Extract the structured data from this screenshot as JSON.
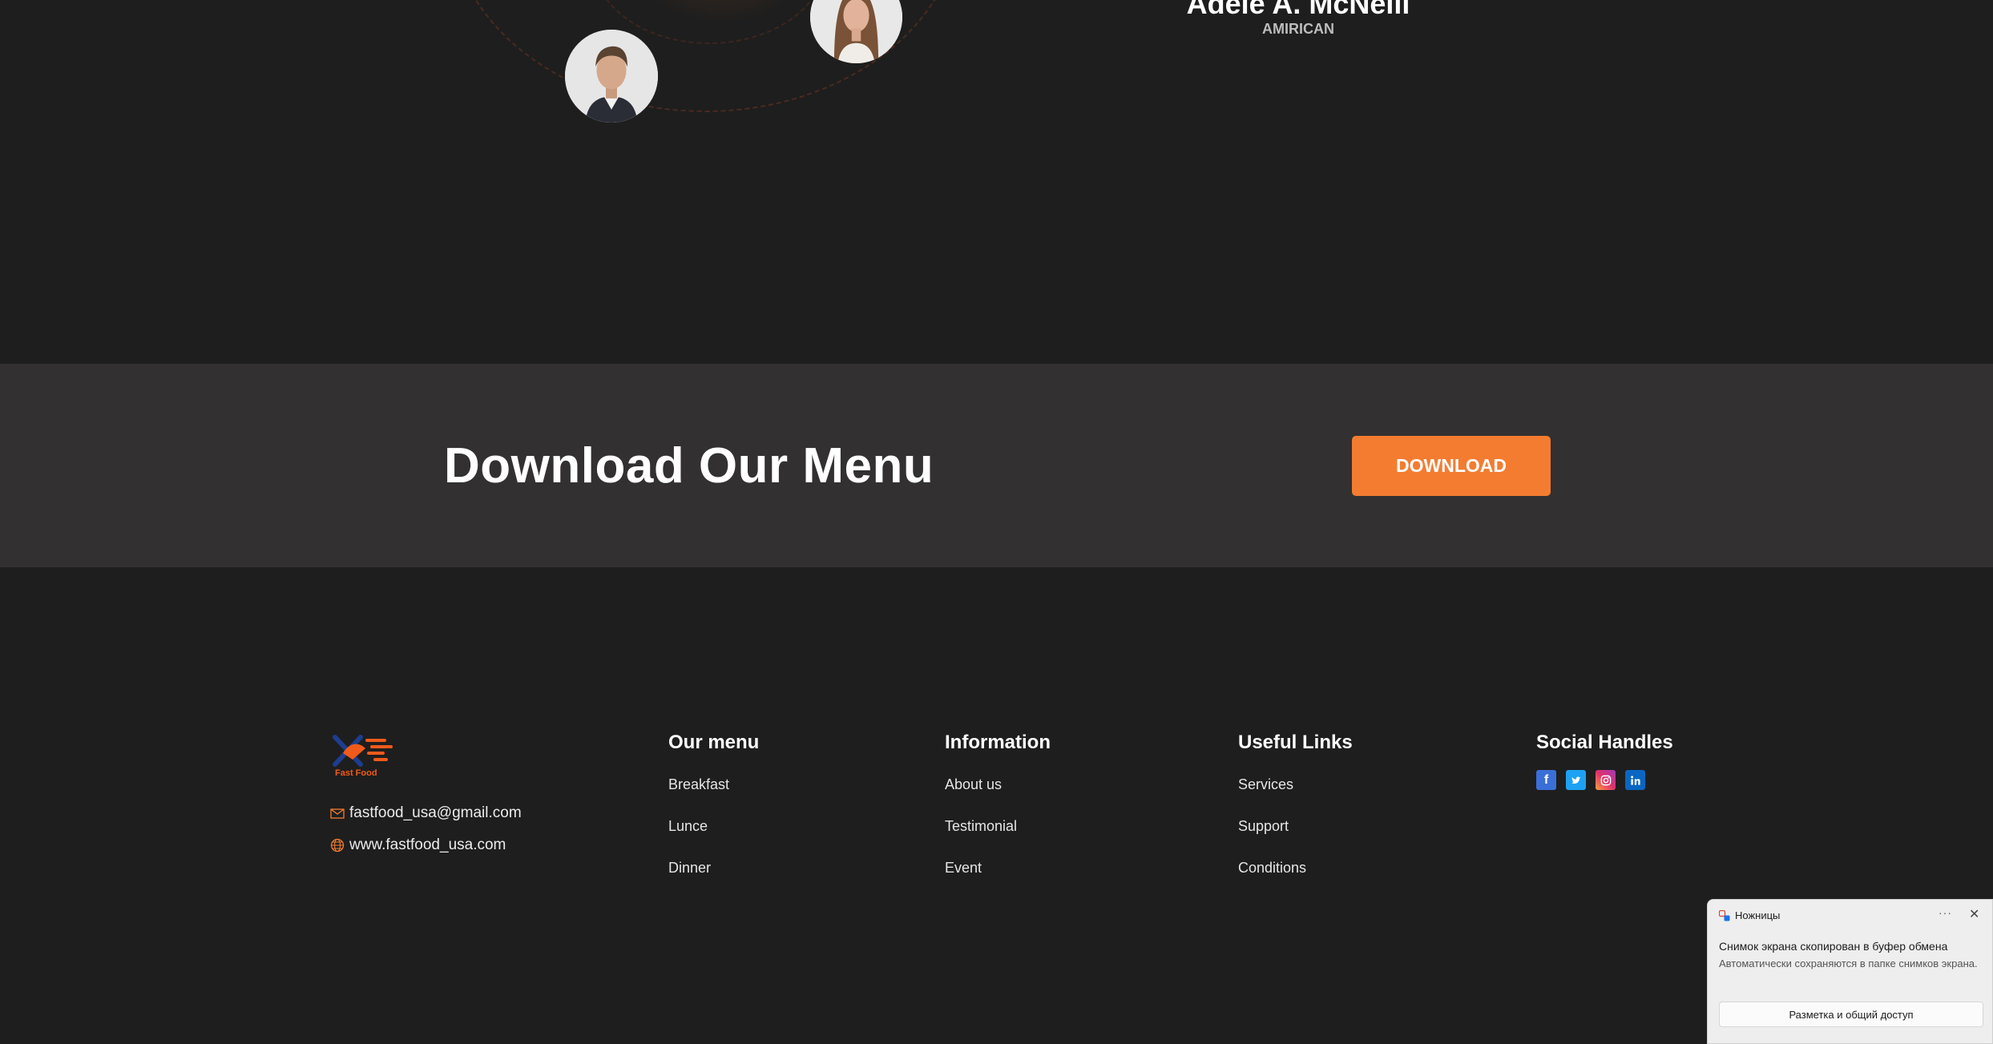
{
  "testimonial": {
    "name": "Adele A. McNeill",
    "origin": "AMIRICAN"
  },
  "download": {
    "title": "Download Our Menu",
    "button_label": "DOWNLOAD"
  },
  "footer": {
    "logo_text": "Fast Food",
    "email": "fastfood_usa@gmail.com",
    "website": "www.fastfood_usa.com",
    "columns": [
      {
        "heading": "Our menu",
        "links": [
          "Breakfast",
          "Lunce",
          "Dinner"
        ]
      },
      {
        "heading": "Information",
        "links": [
          "About us",
          "Testimonial",
          "Event"
        ]
      },
      {
        "heading": "Useful Links",
        "links": [
          "Services",
          "Support",
          "Conditions"
        ]
      }
    ],
    "social": {
      "heading": "Social Handles",
      "icons": [
        "facebook-icon",
        "twitter-icon",
        "instagram-icon",
        "linkedin-icon"
      ]
    }
  },
  "toast": {
    "app_name": "Ножницы",
    "more": "···",
    "close": "✕",
    "title": "Снимок экрана скопирован в буфер обмена",
    "body": "Автоматически сохраняются в папке снимков экрана.",
    "button_label": "Разметка и общий доступ"
  },
  "colors": {
    "accent": "#f47c30",
    "background": "#1e1e1e",
    "band": "#323031"
  }
}
